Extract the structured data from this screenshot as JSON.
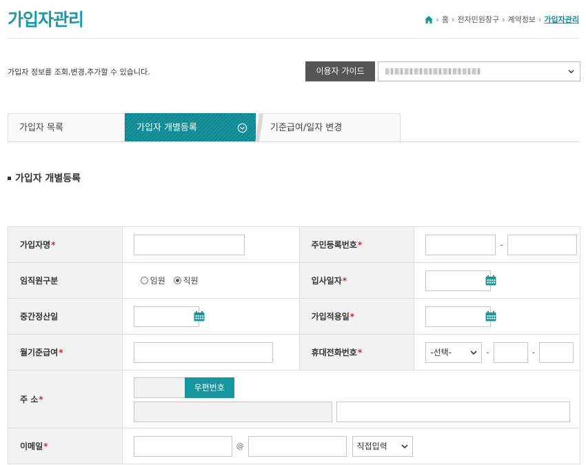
{
  "header": {
    "title": "가입자관리",
    "breadcrumb": [
      "홈",
      "전자민원창구",
      "계약정보",
      "가입자관리"
    ]
  },
  "intro": {
    "description": "가입자 정보를 조회,변경,추가할 수 있습니다.",
    "guide_button": "이용자 가이드"
  },
  "tabs": [
    {
      "label": "가입자 목록",
      "active": false
    },
    {
      "label": "가입자 개별등록",
      "active": true
    },
    {
      "label": "기준급여/일자 변경",
      "active": false
    }
  ],
  "section": {
    "title": "가입자 개별등록"
  },
  "form": {
    "name_label": "가입자명",
    "rrn_label": "주민등록번호",
    "rrn_sep": "-",
    "emp_type_label": "임직원구분",
    "emp_type_options": [
      "임원",
      "직원"
    ],
    "emp_type_selected": "직원",
    "join_date_label": "입사일자",
    "interim_label": "중간정산일",
    "apply_date_label": "가입적용일",
    "salary_label": "월기준급여",
    "phone_label": "휴대전화번호",
    "phone_prefix_selected": "-선택-",
    "phone_sep": "-",
    "address_label": "주 소",
    "zip_button": "우편번호",
    "email_label": "이메일",
    "email_at": "@",
    "email_domain_selected": "직접입력",
    "required_mark": "*"
  },
  "colors": {
    "accent": "#1796a0",
    "required": "#dd2222",
    "label_bg": "#f2f2f2"
  }
}
